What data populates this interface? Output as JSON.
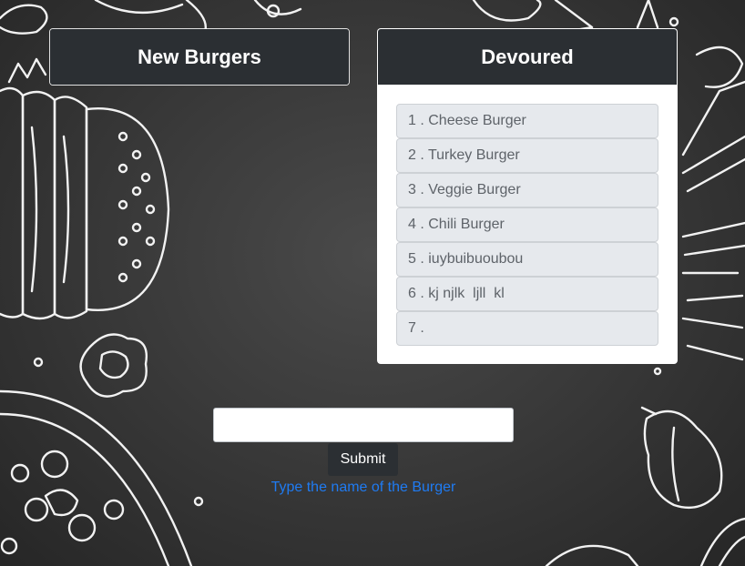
{
  "new_burgers": {
    "title": "New Burgers"
  },
  "devoured": {
    "title": "Devoured",
    "items": [
      {
        "label": "1 . Cheese Burger"
      },
      {
        "label": "2 . Turkey Burger"
      },
      {
        "label": "3 . Veggie Burger"
      },
      {
        "label": "4 . Chili Burger"
      },
      {
        "label": "5 . iuybuibuoubou"
      },
      {
        "label": "6 . kj njlk  ljll  kl"
      },
      {
        "label": "7 . "
      }
    ]
  },
  "form": {
    "input_value": "",
    "input_placeholder": "",
    "submit_label": "Submit",
    "help_text": "Type the name of the Burger"
  },
  "colors": {
    "card_header": "#2b2f33",
    "item_bg": "#e6e9ed",
    "help_text": "#1f7bf2",
    "background": "#3a3a3a"
  }
}
